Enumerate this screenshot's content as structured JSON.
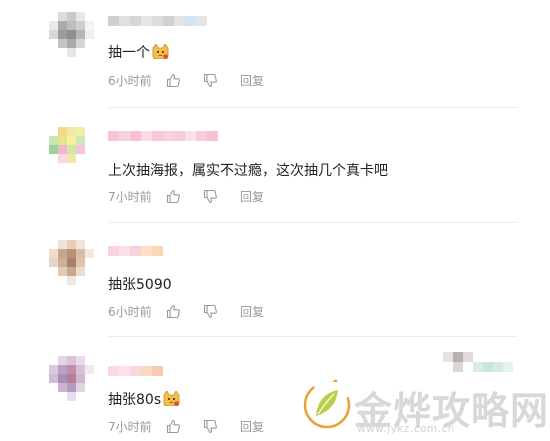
{
  "comments": [
    {
      "text": "抽一个",
      "has_emoji": true,
      "time": "6小时前",
      "reply_label": "回复",
      "avatar_colors": [
        "#fff",
        "#dcdcdc",
        "#c9c9c9",
        "#e8e8e8",
        "#fff",
        "#eaeaea",
        "#a9a9a9",
        "#bdbdbd",
        "#cfcfcf",
        "#f4f4f4",
        "#d9d9d9",
        "#9b9b9b",
        "#8f8f8f",
        "#b5b5b5",
        "#eeeeee",
        "#fff",
        "#c4c4c4",
        "#aaaaaa",
        "#d6d6d6",
        "#fff",
        "#fff",
        "#fff",
        "#e6e6e6",
        "#fff",
        "#fff"
      ],
      "name_colors": [
        "#cfcfcf",
        "#e0e0e0",
        "#d6d6d6",
        "#e6e6e6",
        "#dcdcdc",
        "#d2d2d2",
        "#e3e3e3",
        "#cfe5f5",
        "#e5e5e5"
      ]
    },
    {
      "text": "上次抽海报，属实不过瘾，这次抽几个真卡吧",
      "has_emoji": false,
      "time": "7小时前",
      "reply_label": "回复",
      "avatar_colors": [
        "#fff",
        "#f3d98a",
        "#f6e6a8",
        "#eef2a0",
        "#fff",
        "#c9e5b5",
        "#e6e38f",
        "#f7ef9c",
        "#cde7c1",
        "#fff",
        "#9fd39a",
        "#f0b8cc",
        "#cfe8a8",
        "#f5c7d3",
        "#fff",
        "#fff",
        "#fad7e2",
        "#f1e7a6",
        "#fff",
        "#fff",
        "#fff",
        "#fff",
        "#fff",
        "#fff",
        "#fff"
      ],
      "name_colors": [
        "#f7c4d4",
        "#f9d2de",
        "#f6c0d0",
        "#fbdbe5",
        "#f7c8d6",
        "#fad0dc",
        "#f8cad8",
        "#fbe1e9",
        "#f9ccd9",
        "#f6c2d1"
      ]
    },
    {
      "text": "抽张5090",
      "has_emoji": false,
      "time": "6小时前",
      "reply_label": "回复",
      "avatar_colors": [
        "#fff",
        "#efe3d8",
        "#e7cdb9",
        "#f2e4d9",
        "#fff",
        "#f1dccd",
        "#c7a58f",
        "#b99078",
        "#d9bba6",
        "#f4e7dd",
        "#e9d5c5",
        "#d0ae95",
        "#a8816a",
        "#e0c2ad",
        "#fff",
        "#fff",
        "#e4c9b6",
        "#c9a68e",
        "#ecdcd0",
        "#fff",
        "#fff",
        "#fff",
        "#f3e6dc",
        "#fff",
        "#fff"
      ],
      "name_colors": [
        "#f9d3de",
        "#fbe0e8",
        "#f8d0dc",
        "#fcdfc6",
        "#fbd7b5"
      ]
    },
    {
      "text": "抽张80s",
      "has_emoji": true,
      "time": "7小时前",
      "reply_label": "回复",
      "avatar_colors": [
        "#fff",
        "#e4d2e6",
        "#d9c2da",
        "#e8dceb",
        "#fff",
        "#d8c8e0",
        "#b8a1c7",
        "#c28fa8",
        "#d6c2d8",
        "#f1e8f2",
        "#cfbdd6",
        "#a58fb5",
        "#b47e98",
        "#d1b6cc",
        "#fff",
        "#fff",
        "#cbb5ce",
        "#b39ec0",
        "#e3d2e2",
        "#fff",
        "#fff",
        "#fff",
        "#e9dde9",
        "#fff",
        "#fff"
      ],
      "name_colors": [
        "#fbd9e2",
        "#fce3ea",
        "#fad6df",
        "#fbd8c2",
        "#f8cab0"
      ]
    }
  ],
  "watermark": {
    "title": "金烨攻略网",
    "url": "www.jykz.com.cn",
    "leaf_color": "#b7cf4a",
    "ring_color": "#e8a23a"
  },
  "colors": {
    "meta_gray": "#999999",
    "text": "#222222",
    "divider": "#ececec"
  },
  "icons": [
    "thumbs-up-icon",
    "thumbs-down-icon",
    "cat-emoji-icon"
  ]
}
